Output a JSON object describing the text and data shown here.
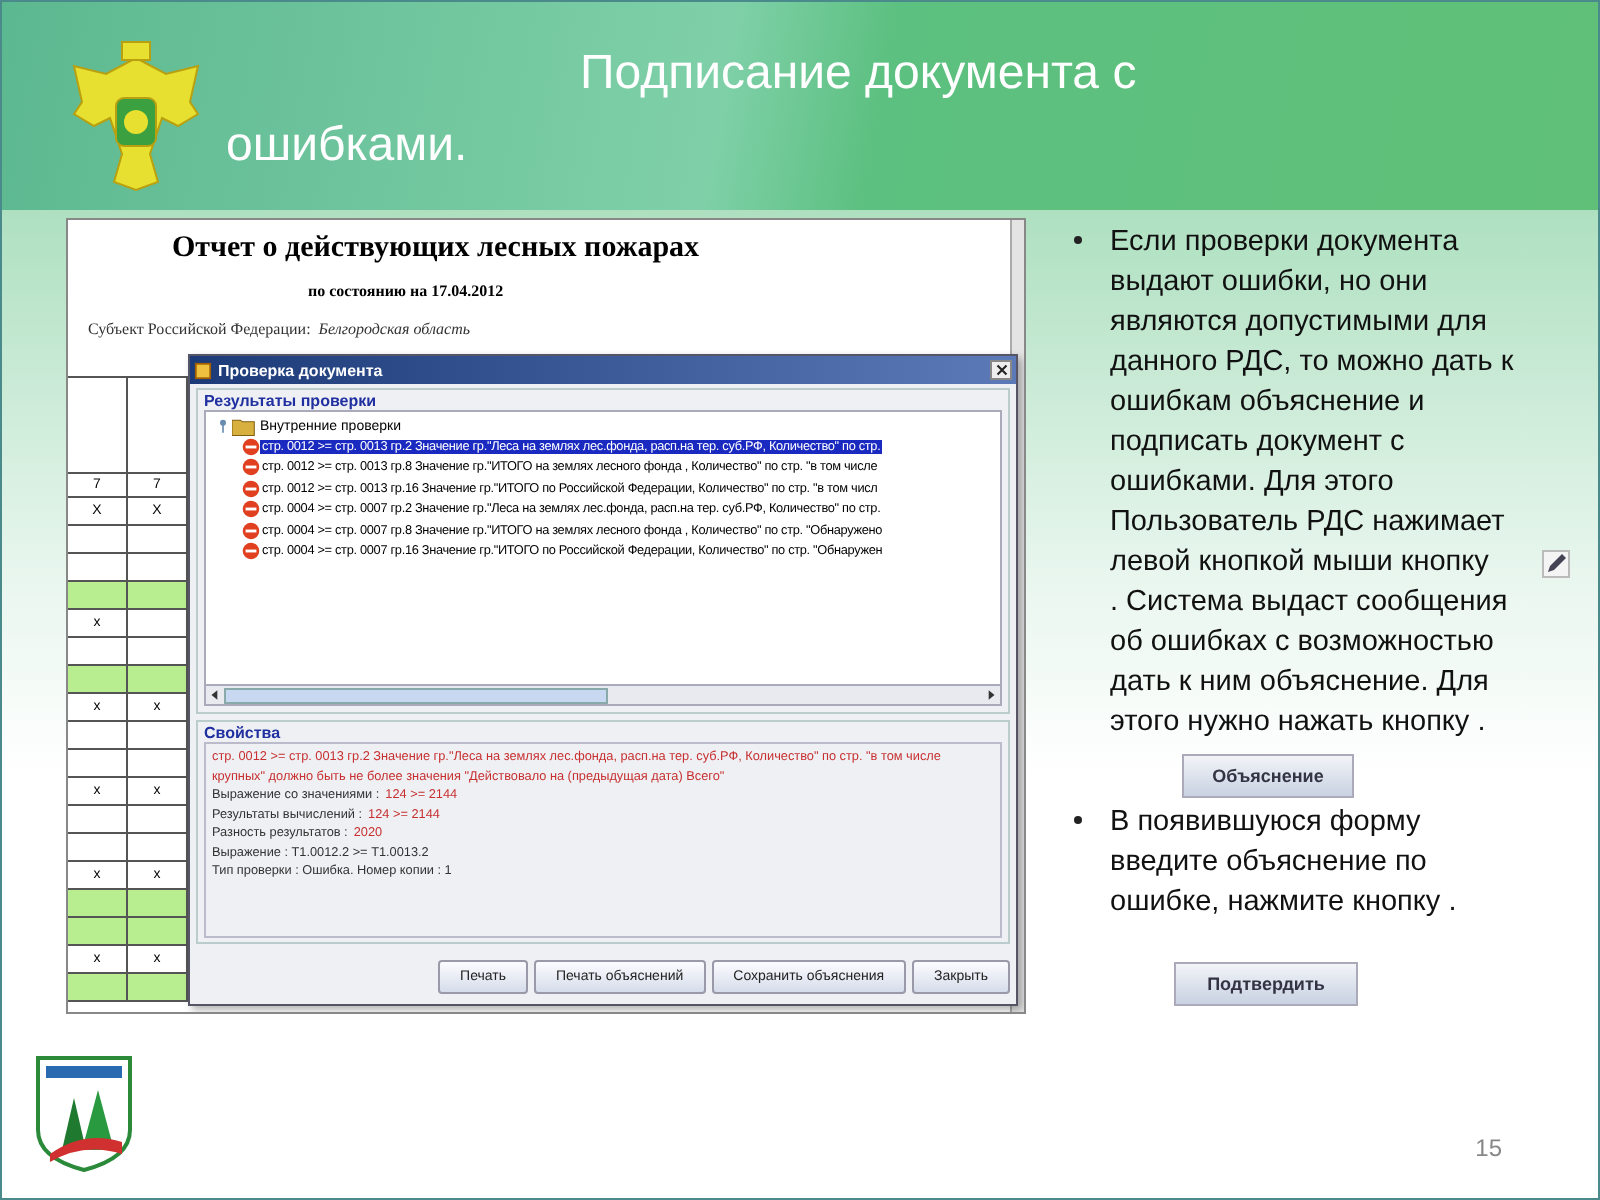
{
  "slide": {
    "title": "Подписание документа с ошибками.",
    "page_number": "15"
  },
  "report": {
    "title": "Отчет о действующих лесных пожарах",
    "date": "по состоянию на 17.04.2012",
    "subject_label": "Субъект Российской Федерации:",
    "subject_value": "Белгородская область",
    "header_row": [
      "7",
      "7"
    ],
    "rows": [
      {
        "marks": [
          "X",
          "X"
        ],
        "shaded": false
      },
      {
        "shaded": false
      },
      {
        "shaded": false
      },
      {
        "shaded": true
      },
      {
        "marks": [
          "x"
        ],
        "shaded": false
      },
      {
        "shaded": false
      },
      {
        "shaded": true
      },
      {
        "marks": [
          "x",
          "x"
        ],
        "shaded": false
      },
      {
        "shaded": false
      },
      {
        "shaded": false
      },
      {
        "marks": [
          "x",
          "x"
        ],
        "shaded": false
      },
      {
        "shaded": false
      },
      {
        "shaded": false
      },
      {
        "marks": [
          "x",
          "x"
        ],
        "shaded": false
      },
      {
        "shaded": true
      },
      {
        "shaded": true
      },
      {
        "marks": [
          "x",
          "x"
        ],
        "shaded": false
      },
      {
        "shaded": true
      }
    ]
  },
  "dialog": {
    "title": "Проверка документа",
    "results_title": "Результаты проверки",
    "tree": {
      "label": "Внутренние проверки",
      "expanded": true,
      "children": [
        {
          "label": "стр. 0012 >= стр. 0013 гр.2  Значение гр.\"Леса на землях лес.фонда, расп.на тер. суб.РФ, Количество\" по стр.",
          "selected": true
        },
        {
          "label": "стр. 0012 >= стр. 0013 гр.8  Значение гр.\"ИТОГО на землях  лесного фонда , Количество\" по стр. \"в том числе",
          "selected": false
        },
        {
          "label": "стр. 0012 >= стр. 0013 гр.16  Значение гр.\"ИТОГО по  Российской Федерации, Количество\" по стр. \"в том числ",
          "selected": false
        },
        {
          "label": "стр. 0004 >= стр. 0007 гр.2  Значение гр.\"Леса на землях лес.фонда, расп.на тер. суб.РФ, Количество\" по стр.",
          "selected": false
        },
        {
          "label": "стр. 0004 >= стр. 0007 гр.8  Значение гр.\"ИТОГО на землях  лесного фонда , Количество\" по стр. \"Обнаружено",
          "selected": false
        },
        {
          "label": "стр. 0004 >= стр. 0007 гр.16  Значение гр.\"ИТОГО по  Российской Федерации, Количество\" по стр. \"Обнаружен",
          "selected": false
        }
      ]
    },
    "properties_title": "Свойства",
    "properties_message": "стр. 0012 >= стр. 0013 гр.2  Значение гр.\"Леса на землях лес.фонда, расп.на тер. суб.РФ, Количество\" по стр. \"в том числе крупных\" должно быть не более значения \"Действовало на (предыдущая дата) Всего\"",
    "properties": [
      {
        "label": "Выражение со значениями :",
        "value": "124 >= 2144"
      },
      {
        "label": "Результаты вычислений :",
        "value": "124 >= 2144"
      },
      {
        "label": "Разность результатов :",
        "value": "2020"
      },
      {
        "label": "Выражение : Т1.0012.2 >= Т1.0013.2"
      },
      {
        "label": "Тип проверки : Ошибка. Номер копии : 1"
      }
    ],
    "buttons": [
      "Печать",
      "Печать объяснений",
      "Сохранить объяснения",
      "Закрыть"
    ]
  },
  "instructions": {
    "bullet_1_part_1": "Если проверки документа выдают ошибки, но они являются допустимыми для данного РДС, то можно дать к ошибкам объяснение и подписать документ с ошибками. Для этого Пользователь РДС  нажимает левой кнопкой мыши кнопку",
    "bullet_1_part_2": ". Система выдаст сообщения об ошибках с возможностью дать к ним объяснение. Для этого нужно нажать кнопку .",
    "explain_button": "Объяснение",
    "bullet_2": "В появившуюся форму введите объяснение по ошибке, нажмите кнопку .",
    "confirm_button": "Подтвердить"
  }
}
